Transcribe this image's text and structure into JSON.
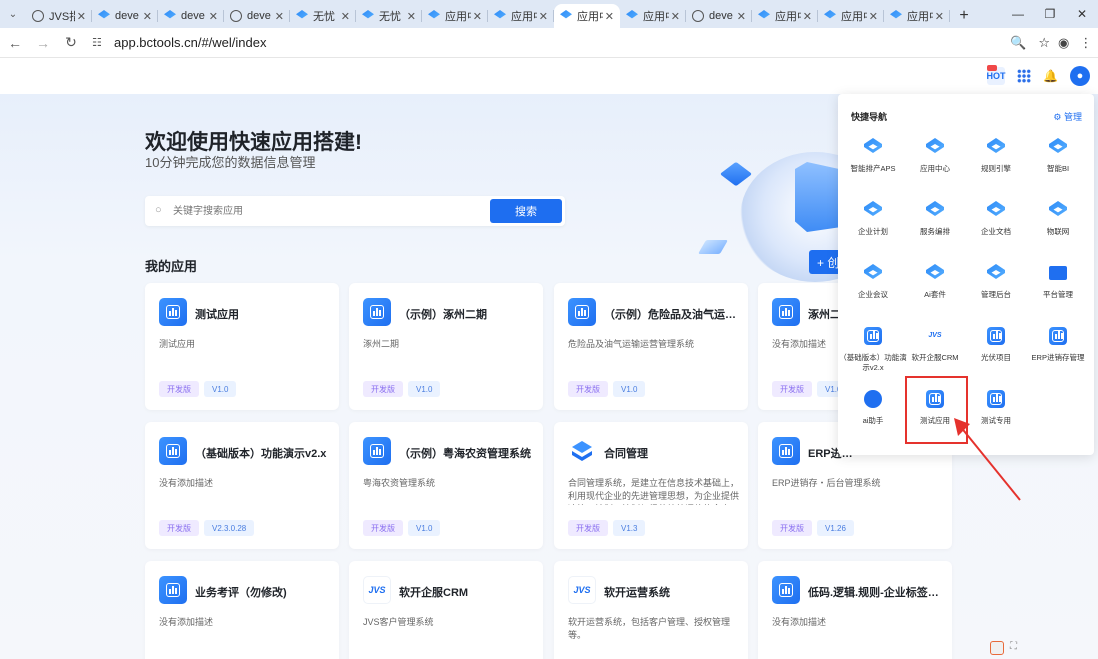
{
  "browser": {
    "tabs": [
      {
        "title": "JVS指",
        "icon": "globe-icon",
        "active": false
      },
      {
        "title": "deve",
        "icon": "cube-icon",
        "active": false
      },
      {
        "title": "deve",
        "icon": "cube-icon",
        "active": false
      },
      {
        "title": "deve",
        "icon": "globe-icon",
        "active": false
      },
      {
        "title": "无忧",
        "icon": "cube-icon",
        "active": false
      },
      {
        "title": "无忧",
        "icon": "cube-icon",
        "active": false
      },
      {
        "title": "应用中",
        "icon": "cube-icon",
        "active": false
      },
      {
        "title": "应用中",
        "icon": "cube-icon",
        "active": false
      },
      {
        "title": "应用中",
        "icon": "cube-icon",
        "active": true
      },
      {
        "title": "应用中",
        "icon": "cube-icon",
        "active": false
      },
      {
        "title": "deve",
        "icon": "globe-icon",
        "active": false
      },
      {
        "title": "应用中",
        "icon": "cube-icon",
        "active": false
      },
      {
        "title": "应用中",
        "icon": "cube-icon",
        "active": false
      },
      {
        "title": "应用中",
        "icon": "cube-icon",
        "active": false
      }
    ],
    "url": "app.bctools.cn/#/wel/index"
  },
  "header": {
    "hot_label": "HOT"
  },
  "hero": {
    "title": "欢迎使用快速应用搭建!",
    "subtitle": "10分钟完成您的数据信息管理",
    "search_placeholder": "关键字搜索应用",
    "search_button": "搜索",
    "create_button": "+ 创"
  },
  "section_title": "我的应用",
  "apps": [
    {
      "name": "测试应用",
      "desc": "测试应用",
      "tag1": "开发版",
      "tag2": "V1.0",
      "icon": "chart-icon"
    },
    {
      "name": "（示例）涿州二期",
      "desc": "涿州二期",
      "tag1": "开发版",
      "tag2": "V1.0",
      "icon": "chart-icon"
    },
    {
      "name": "（示例）危险品及油气运输…",
      "desc": "危险品及油气运输运营管理系统",
      "tag1": "开发版",
      "tag2": "V1.0",
      "icon": "chart-icon"
    },
    {
      "name": "涿州二",
      "desc": "没有添加描述",
      "tag1": "开发版",
      "tag2": "V1.0",
      "icon": "chart-icon"
    },
    {
      "name": "（基础版本）功能演示v2.x",
      "desc": "没有添加描述",
      "tag1": "开发版",
      "tag2": "V2.3.0.28",
      "icon": "chart-icon"
    },
    {
      "name": "（示例）粤海农资管理系统",
      "desc": "粤海农资管理系统",
      "tag1": "开发版",
      "tag2": "V1.0",
      "icon": "chart-icon"
    },
    {
      "name": "合同管理",
      "desc": "合同管理系统，是建立在信息技术基础上，利用现代企业的先进管理思想，为企业提供决策、计划、控制与经营绩效评估的全方…",
      "tag1": "开发版",
      "tag2": "V1.3",
      "icon": "logo-icon"
    },
    {
      "name": "ERP进…",
      "desc": "ERP进销存・后台管理系统",
      "tag1": "开发版",
      "tag2": "V1.26",
      "icon": "chart-icon"
    },
    {
      "name": "业务考评（勿修改)",
      "desc": "没有添加描述",
      "tag1": "",
      "tag2": "",
      "icon": "chart-icon"
    },
    {
      "name": "软开企服CRM",
      "desc": "JVS客户管理系统",
      "tag1": "",
      "tag2": "",
      "icon": "jvs-icon"
    },
    {
      "name": "软开运营系统",
      "desc": "软开运营系统，包括客户管理、授权管理等。",
      "tag1": "",
      "tag2": "",
      "icon": "jvs-icon"
    },
    {
      "name": "低码.逻辑.规则-企业标签管理",
      "desc": "没有添加描述",
      "tag1": "",
      "tag2": "",
      "icon": "chart-icon"
    }
  ],
  "quick_nav": {
    "title": "快捷导航",
    "manage": "管理",
    "jvs_mark": "JVS",
    "items": [
      {
        "label": "智能排产APS",
        "icon": "cube-icon"
      },
      {
        "label": "应用中心",
        "icon": "cube-icon"
      },
      {
        "label": "规则引擎",
        "icon": "cube-icon"
      },
      {
        "label": "智能BI",
        "icon": "cube-icon"
      },
      {
        "label": "企业计划",
        "icon": "cube-icon"
      },
      {
        "label": "服务编排",
        "icon": "cube-icon"
      },
      {
        "label": "企业文档",
        "icon": "cube-icon"
      },
      {
        "label": "物联网",
        "icon": "cube-icon"
      },
      {
        "label": "企业会议",
        "icon": "cube-icon"
      },
      {
        "label": "Ai套件",
        "icon": "cube-icon"
      },
      {
        "label": "管理后台",
        "icon": "cube-icon"
      },
      {
        "label": "平台管理",
        "icon": "platform-icon"
      },
      {
        "label": "（基础版本）功能演示v2.x",
        "icon": "app-icon"
      },
      {
        "label": "软开企服CRM",
        "icon": "jvs-icon"
      },
      {
        "label": "光伏项目",
        "icon": "app-icon"
      },
      {
        "label": "ERP进销存管理",
        "icon": "app-icon"
      },
      {
        "label": "ai助手",
        "icon": "bot-icon"
      },
      {
        "label": "测试应用",
        "icon": "app-icon"
      },
      {
        "label": "测试专用",
        "icon": "app-icon"
      }
    ]
  },
  "colors": {
    "primary": "#1e6ef0",
    "highlight": "#e5322d"
  }
}
